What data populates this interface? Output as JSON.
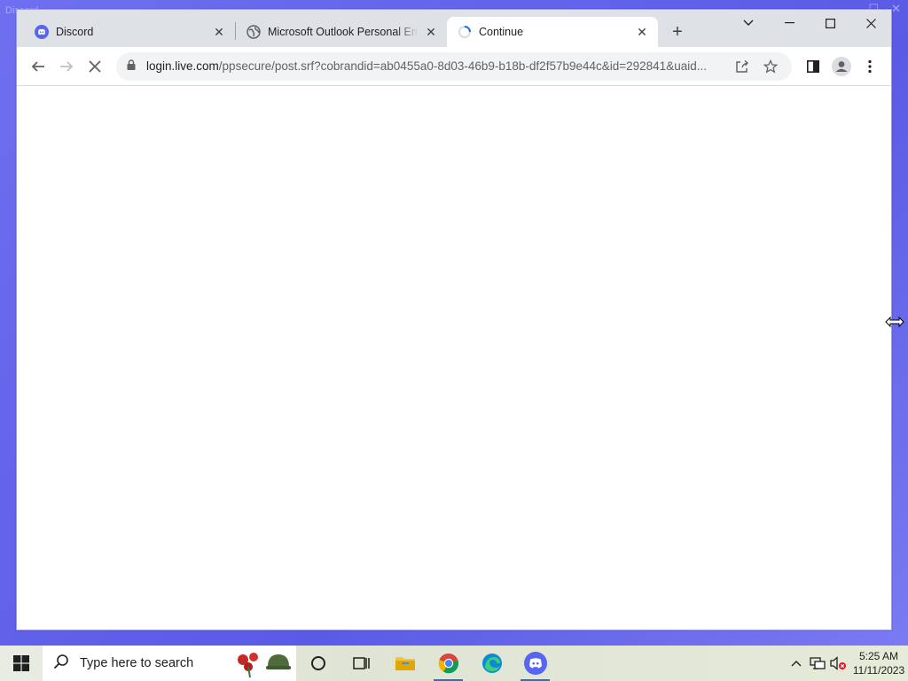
{
  "desktop": {
    "ghost_title": "Discord"
  },
  "browser": {
    "tabs": [
      {
        "title": "Discord",
        "favicon": "discord-icon",
        "active": false
      },
      {
        "title": "Microsoft Outlook Personal Email",
        "favicon": "globe-icon",
        "active": false
      },
      {
        "title": "Continue",
        "favicon": "loading-spinner-icon",
        "active": true
      }
    ],
    "close_glyph": "✕",
    "newtab_glyph": "+",
    "toolbar": {
      "url_host": "login.live.com",
      "url_path": "/ppsecure/post.srf?cobrandid=ab0455a0-8d03-46b9-b18b-df2f57b9e44c&id=292841&uaid..."
    }
  },
  "taskbar": {
    "search_placeholder": "Type here to search",
    "clock_time": "5:25 AM",
    "clock_date": "11/11/2023",
    "pinned": [
      "task-view",
      "file-explorer",
      "chrome",
      "edge",
      "discord"
    ]
  },
  "colors": {
    "desktop_bg": "#6f6ff0",
    "discord": "#5865f2",
    "chrome_tabstrip": "#dee1e6",
    "omnibox": "#f1f3f4"
  }
}
